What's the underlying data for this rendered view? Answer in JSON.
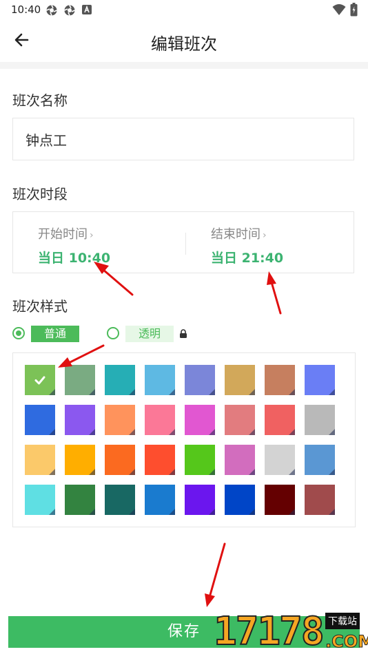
{
  "status_bar": {
    "time": "10:40"
  },
  "app_bar": {
    "title": "编辑班次"
  },
  "shift_name": {
    "label": "班次名称",
    "value": "钟点工"
  },
  "shift_period": {
    "label": "班次时段",
    "start": {
      "label": "开始时间",
      "value": "当日 10:40"
    },
    "end": {
      "label": "结束时间",
      "value": "当日 21:40"
    }
  },
  "shift_style": {
    "label": "班次样式",
    "options": [
      {
        "label": "普通",
        "selected": true
      },
      {
        "label": "透明",
        "selected": false
      }
    ]
  },
  "palette": {
    "selected_index": 0,
    "colors": [
      "#7cc257",
      "#7aab82",
      "#26aeb5",
      "#5eb9e3",
      "#7b86d9",
      "#d2a85a",
      "#c67f5f",
      "#6a7ef5",
      "#2f6be0",
      "#8b58ef",
      "#ff935c",
      "#fb7897",
      "#e157d1",
      "#e27c7f",
      "#f06161",
      "#b9b9b9",
      "#fbc96a",
      "#ffae00",
      "#fb6a20",
      "#fe4e2e",
      "#55c71b",
      "#d26dbe",
      "#d3d3d3",
      "#5a97d3",
      "#5fdfe3",
      "#338340",
      "#186863",
      "#1a7bcf",
      "#6b16ee",
      "#0045c7",
      "#640001",
      "#a04b4c"
    ]
  },
  "save_button": {
    "label": "保存"
  },
  "watermark": {
    "number": "17178",
    "tag": "下载站",
    "domain": ".COM"
  },
  "colors": {
    "accent": "#3dbb63",
    "time_value": "#3cb371",
    "annotation_arrow": "#e01010"
  }
}
